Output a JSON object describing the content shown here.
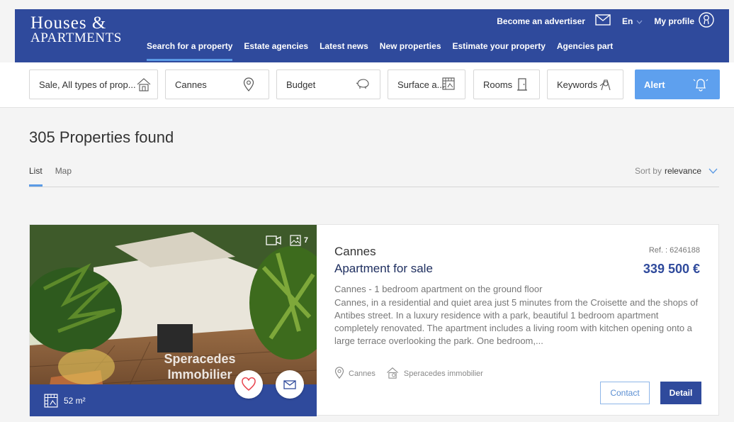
{
  "brand": {
    "line1": "Houses &",
    "line2": "APARTMENTS"
  },
  "topbar": {
    "advertiser": "Become an advertiser",
    "lang": "En",
    "profile": "My profile"
  },
  "nav": [
    "Search for a property",
    "Estate agencies",
    "Latest news",
    "New properties",
    "Estimate your property",
    "Agencies part"
  ],
  "filters": {
    "type": "Sale, All types of prop...",
    "location": "Cannes",
    "budget": "Budget",
    "surface": "Surface a...",
    "rooms": "Rooms",
    "keywords": "Keywords",
    "alert": "Alert"
  },
  "results": {
    "count_text": "305 Properties found"
  },
  "view_tabs": [
    "List",
    "Map"
  ],
  "sort": {
    "label": "Sort by",
    "value": "relevance"
  },
  "listing": {
    "city": "Cannes",
    "type": "Apartment for sale",
    "ref": "Ref. : 6246188",
    "price": "339 500 €",
    "desc_title": "Cannes - 1 bedroom apartment on the ground floor",
    "desc": "Cannes, in a residential and quiet area just 5 minutes from the Croisette and the shops of Antibes street. In a luxury residence with a park, beautiful 1 bedroom apartment completely renovated. The apartment includes a living room with kitchen opening onto a large terrace overlooking the park. One bedroom,...",
    "location": "Cannes",
    "agency": "Speracedes immobilier",
    "photo_count": "7",
    "surface": "52 m²",
    "watermark_1": "Speracedes",
    "watermark_2": "Immobilier",
    "contact_label": "Contact",
    "detail_label": "Detail"
  },
  "colors": {
    "primary": "#2f4a9c",
    "accent": "#5ea0ee"
  }
}
